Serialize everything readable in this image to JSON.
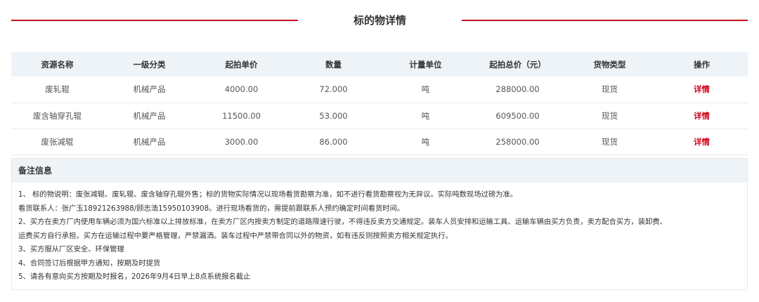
{
  "header": {
    "title": "标的物详情",
    "accent_color": "#c8101c"
  },
  "table": {
    "columns": [
      "资源名称",
      "一级分类",
      "起拍单价",
      "数量",
      "计量单位",
      "起拍总价（元）",
      "货物类型",
      "操作"
    ],
    "rows": [
      {
        "name": "废轧辊",
        "category": "机械产品",
        "unit_price": "4000.00",
        "quantity": "72.000",
        "unit": "吨",
        "total_price": "288000.00",
        "goods_type": "现货",
        "action": "详情"
      },
      {
        "name": "废含轴穿孔辊",
        "category": "机械产品",
        "unit_price": "11500.00",
        "quantity": "53.000",
        "unit": "吨",
        "total_price": "609500.00",
        "goods_type": "现货",
        "action": "详情"
      },
      {
        "name": "废张减辊",
        "category": "机械产品",
        "unit_price": "3000.00",
        "quantity": "86.000",
        "unit": "吨",
        "total_price": "258000.00",
        "goods_type": "现货",
        "action": "详情"
      }
    ]
  },
  "notes": {
    "title": "备注信息",
    "lines": [
      "1、 标的物说明：废张减辊、废轧辊、废含轴穿孔辊外售；标的货物实际情况以现场看货勘察为准，如不进行看货勘察视为无异议。实际吨数现场过磅为准。",
      "看货联系人：张广玉18921263988/顾志浩15950103908。进行现场看货的，需提前跟联系人预约确定时间看货时间。",
      "2、买方在卖方厂内使用车辆必须为国六标准以上排放标准，在卖方厂区内按卖方制定的道路限速行驶，不得违反卖方交通规定。装车人员安排和运输工具、运输车辆由买方负责，卖方配合买方，装卸费、",
      "运费买方自行承担。买方在运输过程中要严格管理，严禁漏洒。装车过程中严禁带合同以外的物资，如有违反则按照卖方相关规定执行。",
      "3、买方服从厂区安全、环保管理",
      "4、合同签订后根据甲方通知，按期及时提货",
      "5、请各有意向买方按期及时报名，2026年9月4日早上8点系统报名截止"
    ]
  }
}
